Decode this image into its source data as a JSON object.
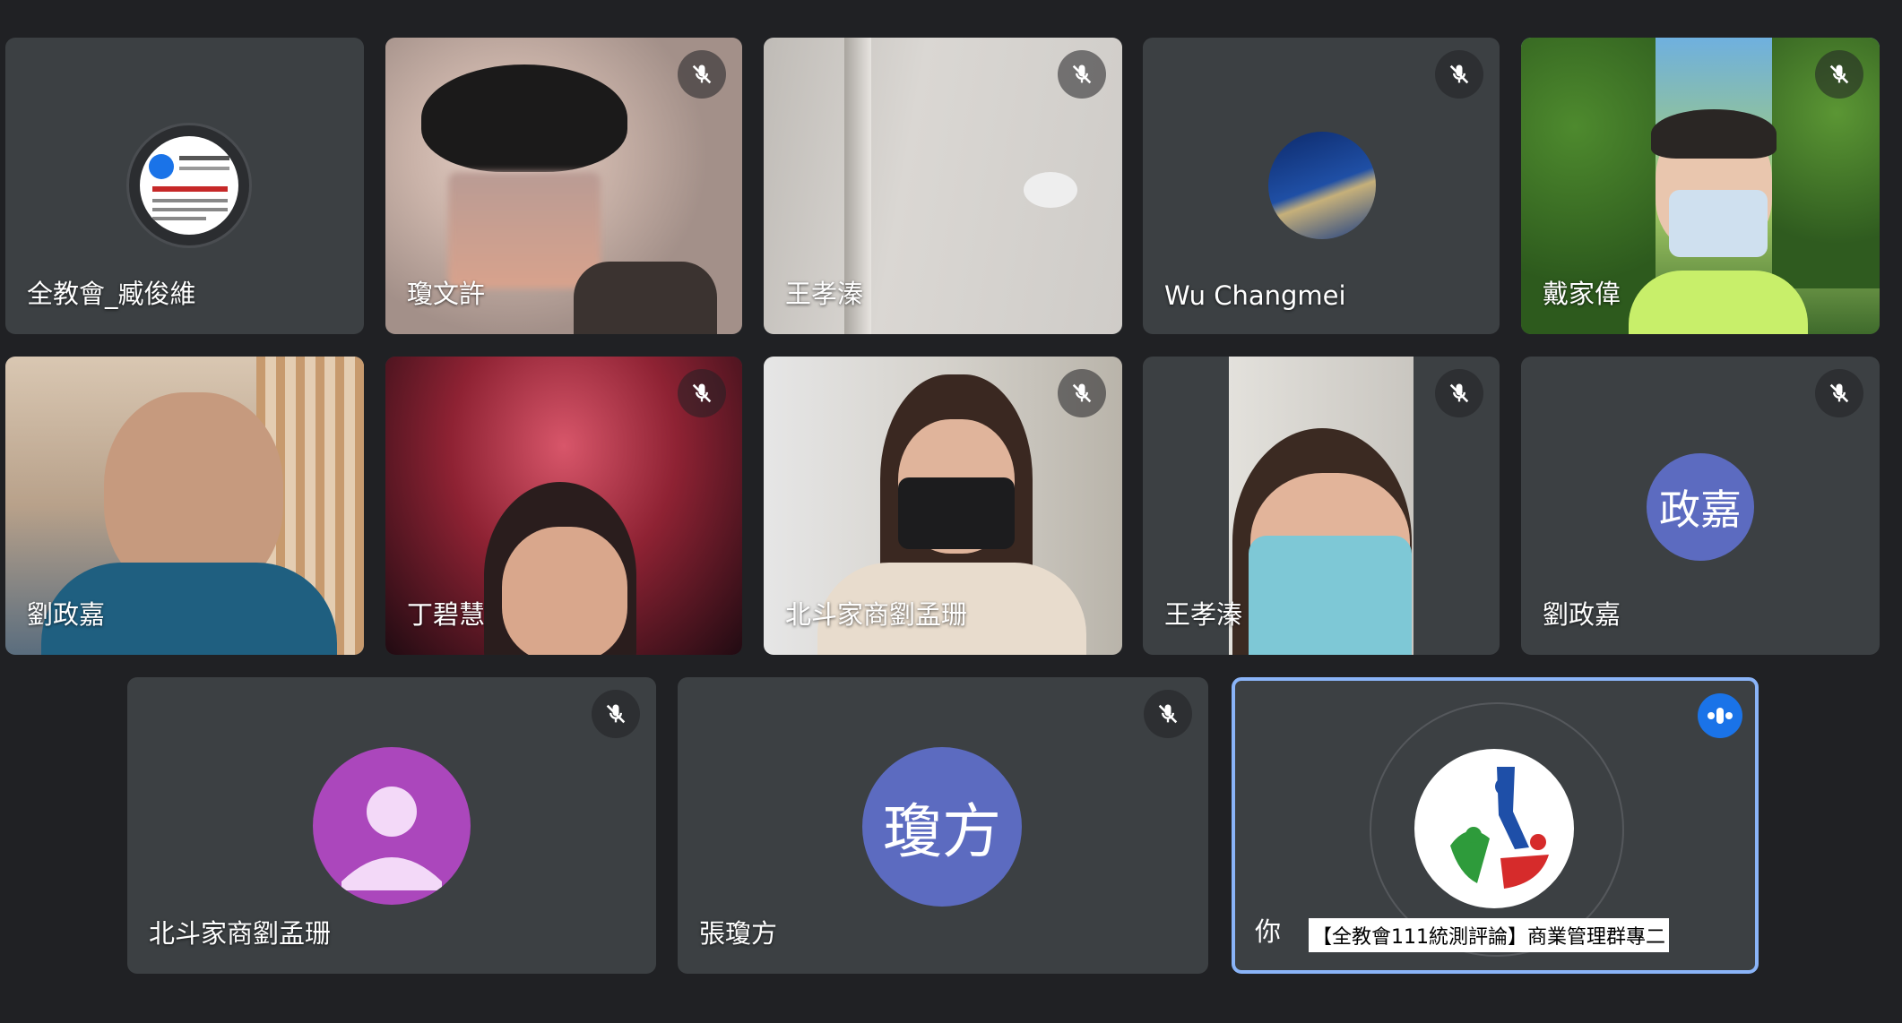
{
  "participants": [
    {
      "name": "全教會_臧俊維"
    },
    {
      "name": "瓊文許"
    },
    {
      "name": "王孝溱"
    },
    {
      "name": "Wu Changmei"
    },
    {
      "name": "戴家偉"
    },
    {
      "name": "劉政嘉"
    },
    {
      "name": "丁碧慧"
    },
    {
      "name": "北斗家商劉孟珊"
    },
    {
      "name": "王孝溱"
    },
    {
      "name": "劉政嘉",
      "initials": "政嘉"
    },
    {
      "name": "北斗家商劉孟珊"
    },
    {
      "name": "張瓊方",
      "initials": "瓊方"
    },
    {
      "name": "你",
      "caption": "【全教會111統測評論】商業管理群專二"
    }
  ],
  "colors": {
    "background": "#202124",
    "tile": "#3c4043",
    "avatar_blue": "#5c6bc0",
    "avatar_purple": "#ab47bc",
    "active_speaker": "#8ab4f8"
  },
  "icons": {
    "mute": "mic-off-icon",
    "speaking": "audio-level-icon",
    "default_avatar": "person-icon"
  }
}
